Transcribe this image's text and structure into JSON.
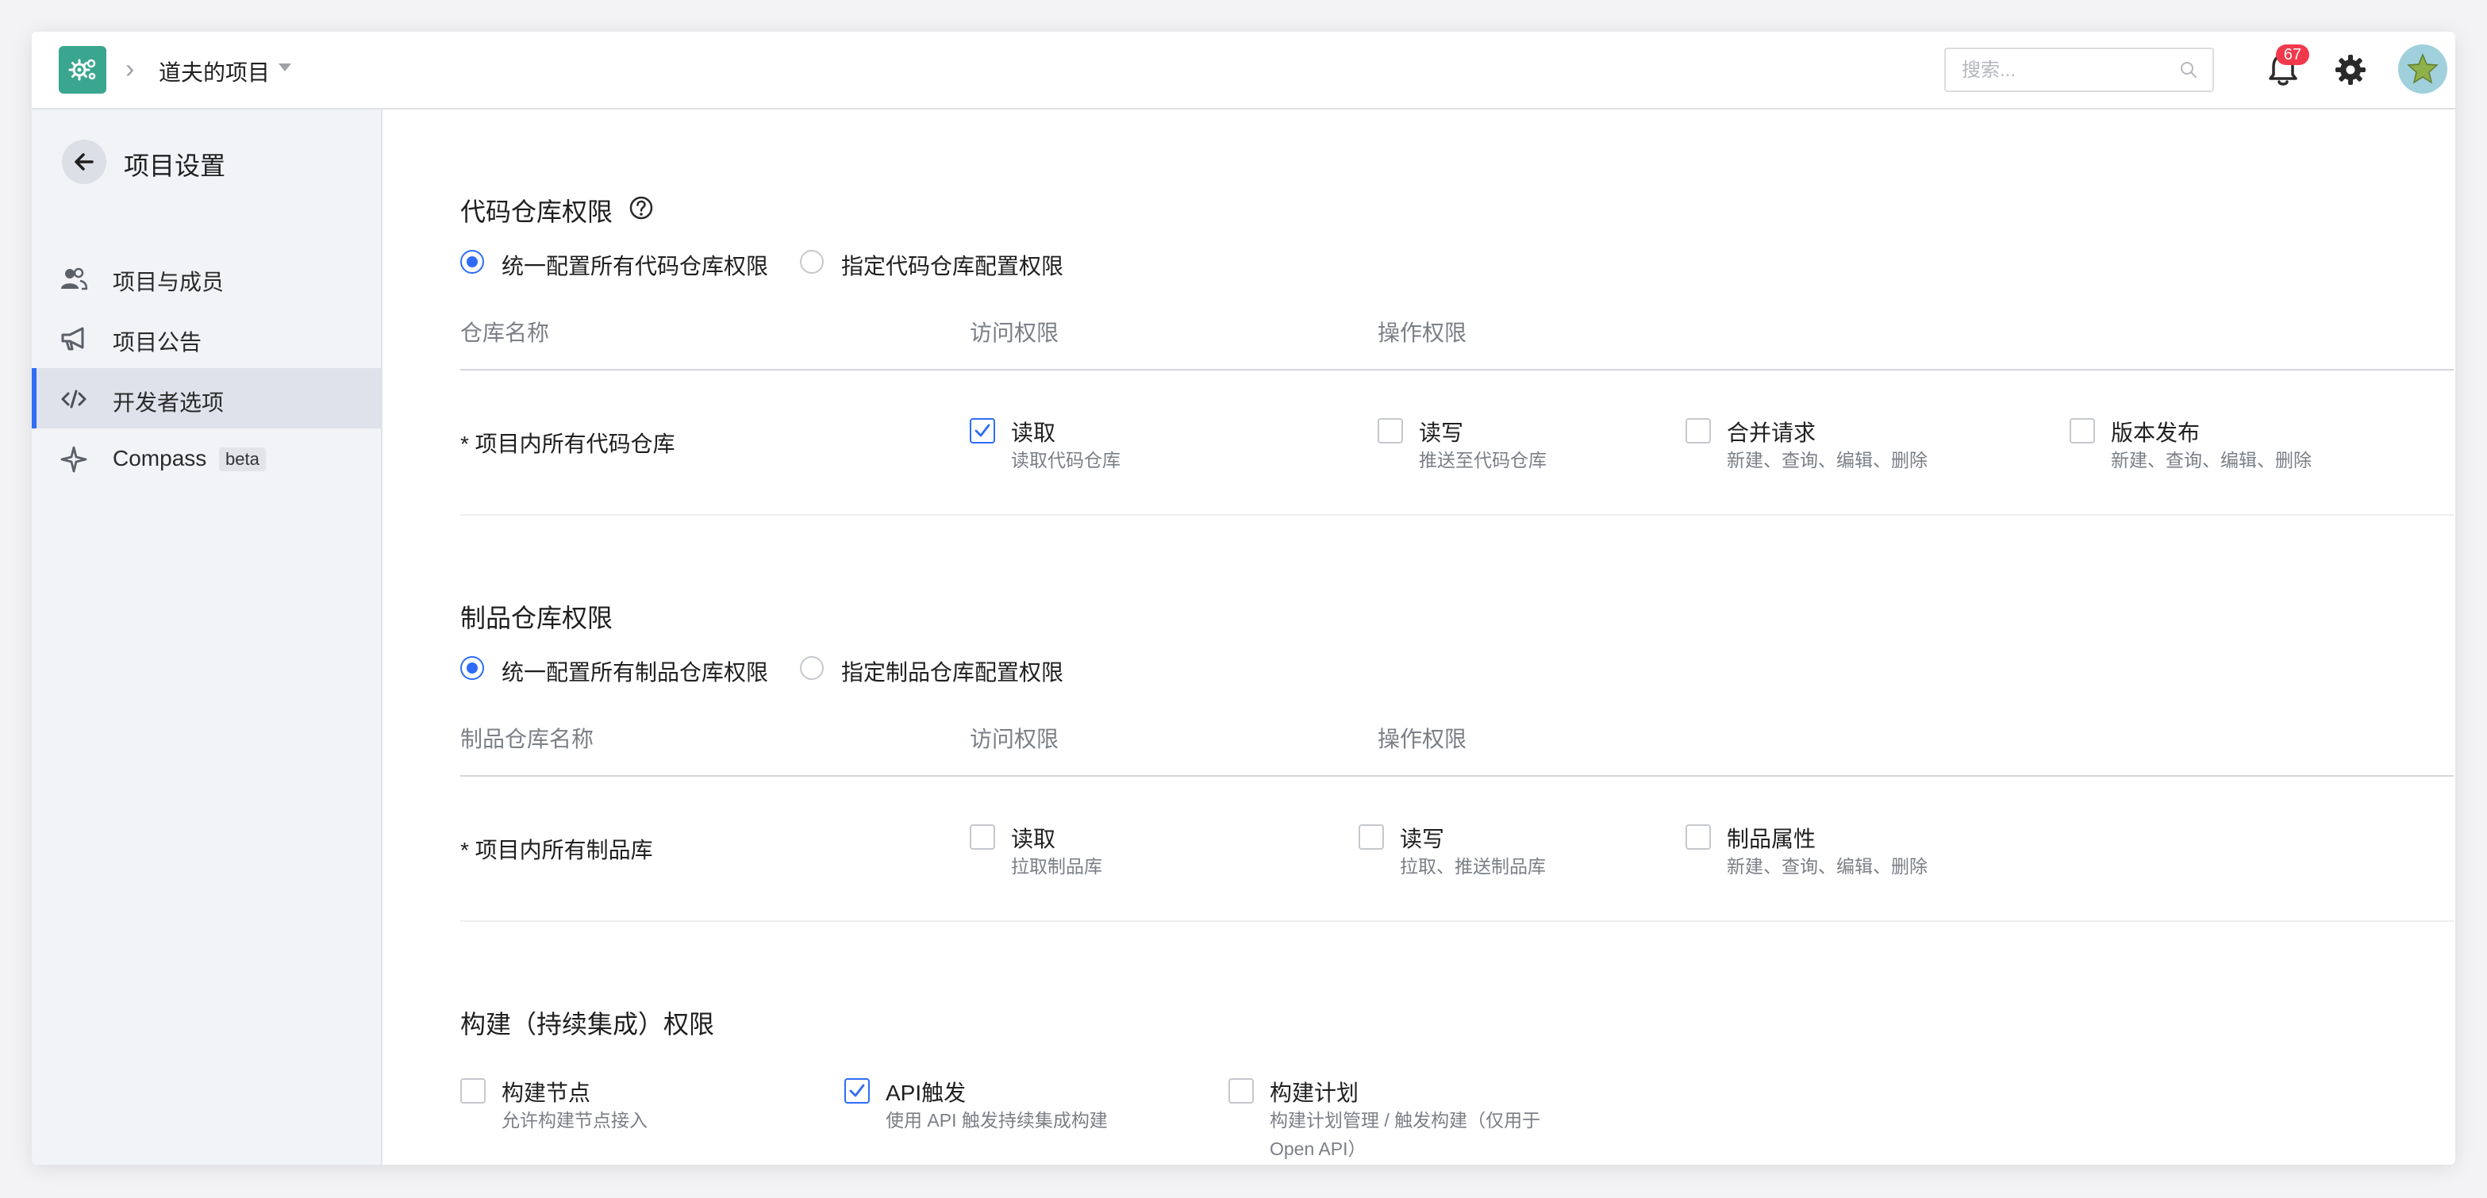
{
  "header": {
    "project_name": "道夫的项目",
    "search_placeholder": "搜索...",
    "notification_count": "67"
  },
  "sidebar": {
    "title": "项目设置",
    "items": [
      {
        "label": "项目与成员",
        "icon": "members-icon"
      },
      {
        "label": "项目公告",
        "icon": "megaphone-icon"
      },
      {
        "label": "开发者选项",
        "icon": "code-icon",
        "active": true
      },
      {
        "label": "Compass",
        "icon": "compass-icon",
        "badge": "beta"
      }
    ]
  },
  "code_repo": {
    "title": "代码仓库权限",
    "radio_unified": "统一配置所有代码仓库权限",
    "radio_specific": "指定代码仓库配置权限",
    "selected": "unified",
    "col_name": "仓库名称",
    "col_access": "访问权限",
    "col_ops": "操作权限",
    "row_label": "* 项目内所有代码仓库",
    "permissions": [
      {
        "label": "读取",
        "desc": "读取代码仓库",
        "checked": true
      },
      {
        "label": "读写",
        "desc": "推送至代码仓库",
        "checked": false
      },
      {
        "label": "合并请求",
        "desc": "新建、查询、编辑、删除",
        "checked": false
      },
      {
        "label": "版本发布",
        "desc": "新建、查询、编辑、删除",
        "checked": false
      }
    ]
  },
  "artifact_repo": {
    "title": "制品仓库权限",
    "radio_unified": "统一配置所有制品仓库权限",
    "radio_specific": "指定制品仓库配置权限",
    "selected": "unified",
    "col_name": "制品仓库名称",
    "col_access": "访问权限",
    "col_ops": "操作权限",
    "row_label": "* 项目内所有制品库",
    "permissions": [
      {
        "label": "读取",
        "desc": "拉取制品库",
        "checked": false
      },
      {
        "label": "读写",
        "desc": "拉取、推送制品库",
        "checked": false
      },
      {
        "label": "制品属性",
        "desc": "新建、查询、编辑、删除",
        "checked": false
      }
    ]
  },
  "ci": {
    "title": "构建（持续集成）权限",
    "permissions": [
      {
        "label": "构建节点",
        "desc": "允许构建节点接入",
        "checked": false
      },
      {
        "label": "API触发",
        "desc": "使用 API 触发持续集成构建",
        "checked": true
      },
      {
        "label": "构建计划",
        "desc": "构建计划管理 / 触发构建（仅用于",
        "desc2": "Open API）",
        "checked": false
      }
    ]
  },
  "colors": {
    "accent": "#2f6df6",
    "logo": "#3aa68f",
    "badge": "#f2394b"
  }
}
